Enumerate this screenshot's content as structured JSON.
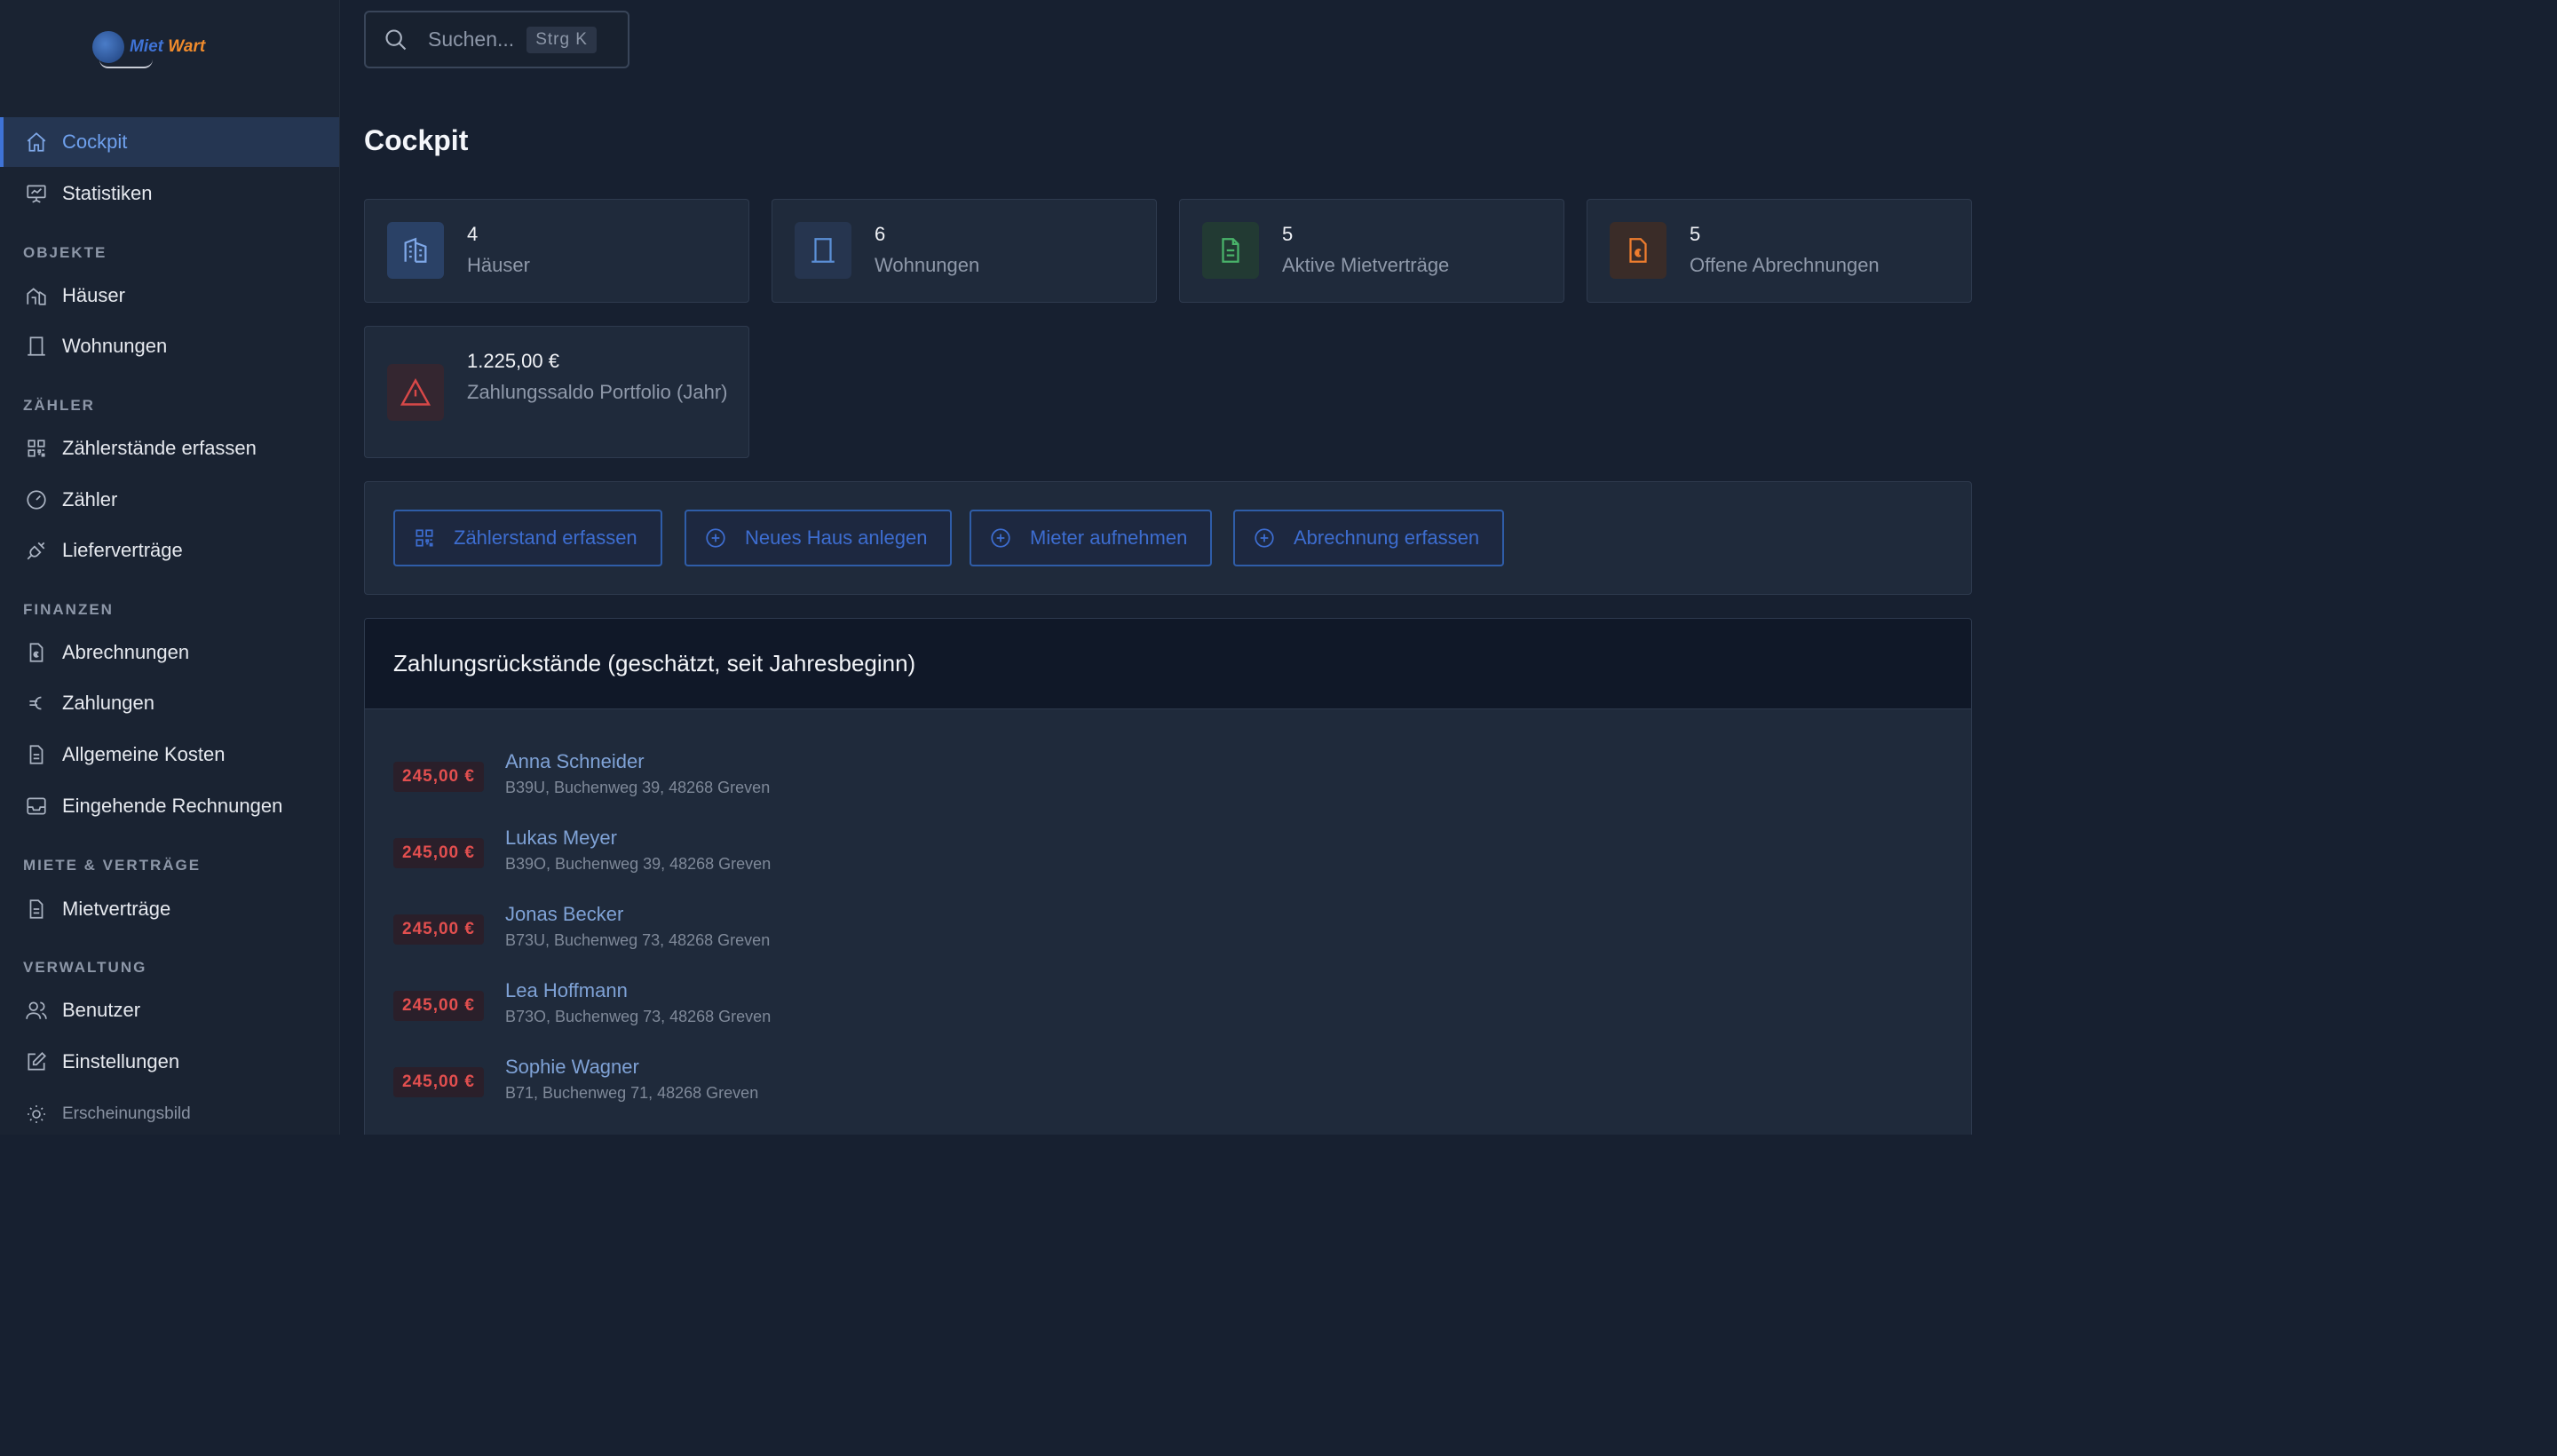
{
  "app": {
    "logo": {
      "word1": "Miet",
      "word2": "Wart"
    },
    "search": {
      "placeholder": "Suchen...",
      "shortcut": "Strg K"
    },
    "page_title": "Cockpit"
  },
  "sidebar": {
    "items": [
      {
        "label": "Cockpit",
        "icon": "home-icon",
        "active": true
      },
      {
        "label": "Statistiken",
        "icon": "presentation-chart-icon"
      }
    ],
    "sections": [
      {
        "title": "OBJEKTE",
        "items": [
          {
            "label": "Häuser",
            "icon": "house-icon"
          },
          {
            "label": "Wohnungen",
            "icon": "door-icon"
          }
        ]
      },
      {
        "title": "ZÄHLER",
        "items": [
          {
            "label": "Zählerstände erfassen",
            "icon": "grid-icon"
          },
          {
            "label": "Zähler",
            "icon": "gauge-icon"
          },
          {
            "label": "Lieferverträge",
            "icon": "plug-icon"
          }
        ]
      },
      {
        "title": "FINANZEN",
        "items": [
          {
            "label": "Abrechnungen",
            "icon": "euro-document-icon"
          },
          {
            "label": "Zahlungen",
            "icon": "euro-icon"
          },
          {
            "label": "Allgemeine Kosten",
            "icon": "document-icon"
          },
          {
            "label": "Eingehende Rechnungen",
            "icon": "inbox-icon"
          }
        ]
      },
      {
        "title": "MIETE & VERTRÄGE",
        "items": [
          {
            "label": "Mietverträge",
            "icon": "document-icon"
          }
        ]
      },
      {
        "title": "VERWALTUNG",
        "items": [
          {
            "label": "Benutzer",
            "icon": "users-icon"
          },
          {
            "label": "Einstellungen",
            "icon": "edit-icon"
          }
        ]
      }
    ],
    "appearance": {
      "label": "Erscheinungsbild",
      "icon": "sun-icon"
    }
  },
  "stats": [
    {
      "value": "4",
      "label": "Häuser",
      "icon": "building-icon",
      "color": "#5b8fd6"
    },
    {
      "value": "6",
      "label": "Wohnungen",
      "icon": "door-icon",
      "color": "#5b8fd6"
    },
    {
      "value": "5",
      "label": "Aktive Mietverträge",
      "icon": "document-icon",
      "color": "#49b36a"
    },
    {
      "value": "5",
      "label": "Offene Abrechnungen",
      "icon": "euro-document-icon",
      "color": "#ef7d2e"
    },
    {
      "value": "1.225,00 €",
      "label": "Zahlungssaldo Portfolio (Jahr)",
      "icon": "warning-icon",
      "color": "#d84848"
    }
  ],
  "quick_actions": [
    {
      "label": "Zählerstand erfassen",
      "icon": "grid-icon"
    },
    {
      "label": "Neues Haus anlegen",
      "icon": "plus-circle-icon"
    },
    {
      "label": "Mieter aufnehmen",
      "icon": "plus-circle-icon"
    },
    {
      "label": "Abrechnung erfassen",
      "icon": "plus-circle-icon"
    }
  ],
  "arrears": {
    "title": "Zahlungsrückstände (geschätzt, seit Jahresbeginn)",
    "rows": [
      {
        "amount": "245,00 €",
        "name": "Anna Schneider",
        "address": "B39U, Buchenweg 39, 48268 Greven"
      },
      {
        "amount": "245,00 €",
        "name": "Lukas Meyer",
        "address": "B39O, Buchenweg 39, 48268 Greven"
      },
      {
        "amount": "245,00 €",
        "name": "Jonas Becker",
        "address": "B73U, Buchenweg 73, 48268 Greven"
      },
      {
        "amount": "245,00 €",
        "name": "Lea Hoffmann",
        "address": "B73O, Buchenweg 73, 48268 Greven"
      },
      {
        "amount": "245,00 €",
        "name": "Sophie Wagner",
        "address": "B71, Buchenweg 71, 48268 Greven"
      }
    ]
  }
}
